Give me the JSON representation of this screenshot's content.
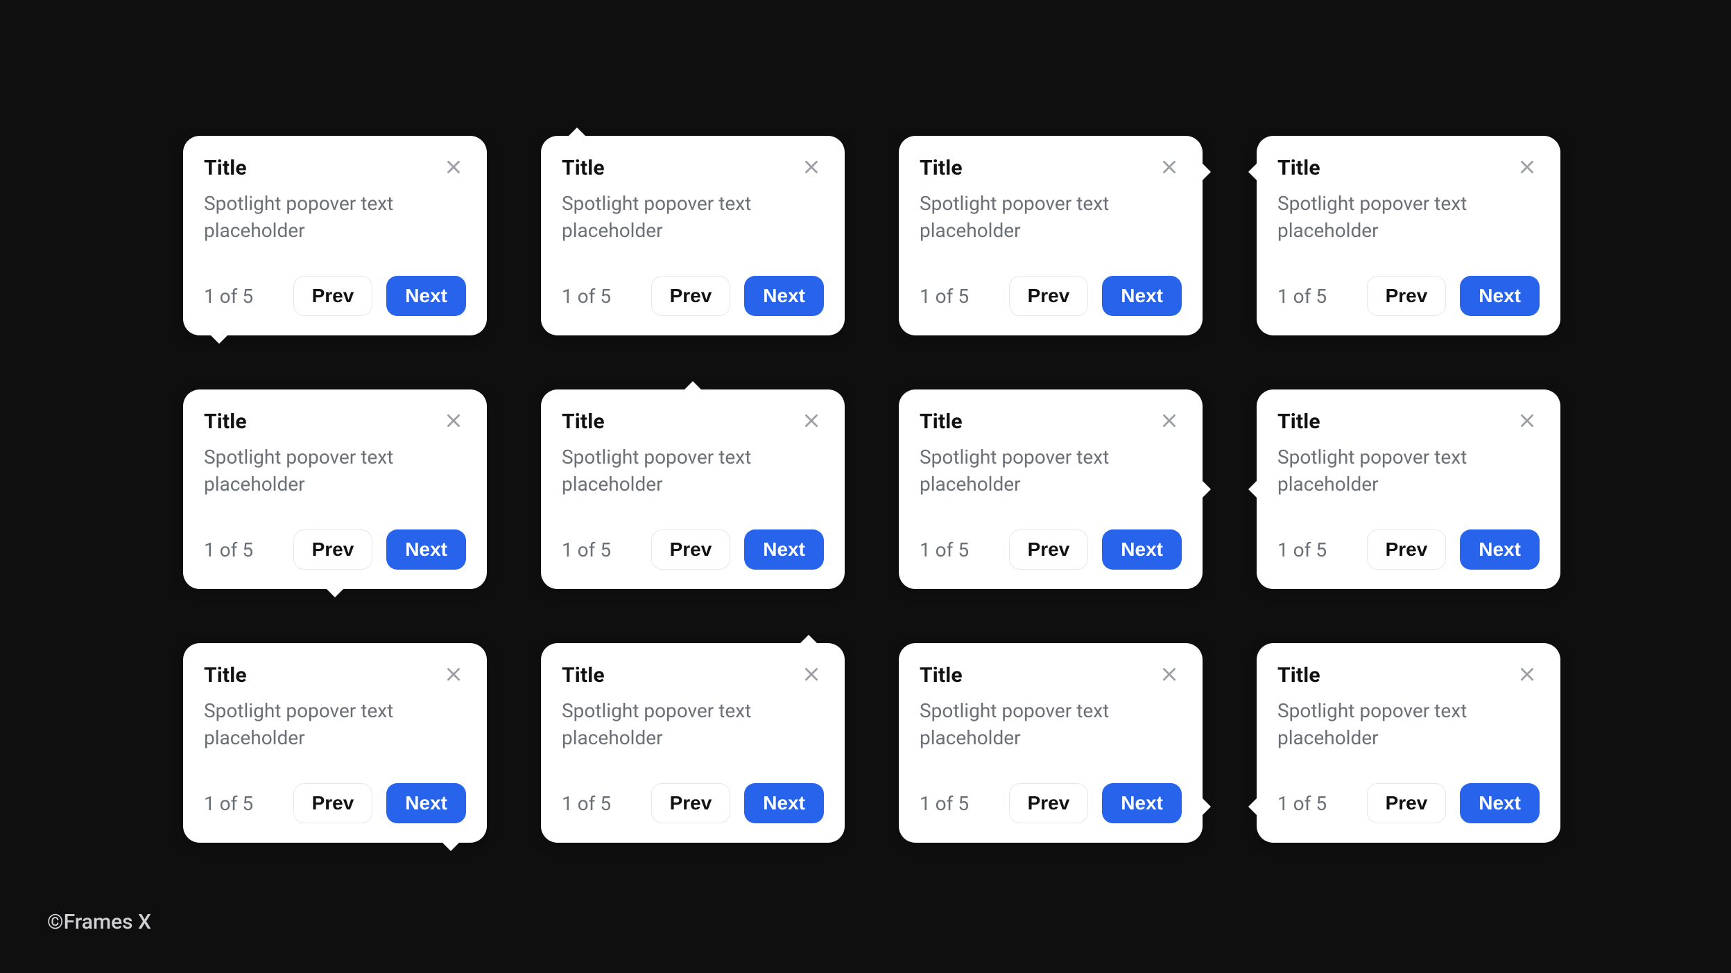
{
  "popover": {
    "title": "Title",
    "body": "Spotlight popover text placeholder",
    "counter": "1 of 5",
    "prev_label": "Prev",
    "next_label": "Next"
  },
  "credit": "©Frames X",
  "arrows": [
    {
      "dir": "down",
      "align": "h-start"
    },
    {
      "dir": "up",
      "align": "h-start"
    },
    {
      "dir": "right",
      "align": "v-top"
    },
    {
      "dir": "left",
      "align": "v-top"
    },
    {
      "dir": "down",
      "align": "h-center"
    },
    {
      "dir": "up",
      "align": "h-center"
    },
    {
      "dir": "right",
      "align": "v-center"
    },
    {
      "dir": "left",
      "align": "v-center"
    },
    {
      "dir": "down",
      "align": "h-end"
    },
    {
      "dir": "up",
      "align": "h-end"
    },
    {
      "dir": "right",
      "align": "v-bottom"
    },
    {
      "dir": "left",
      "align": "v-bottom"
    }
  ]
}
